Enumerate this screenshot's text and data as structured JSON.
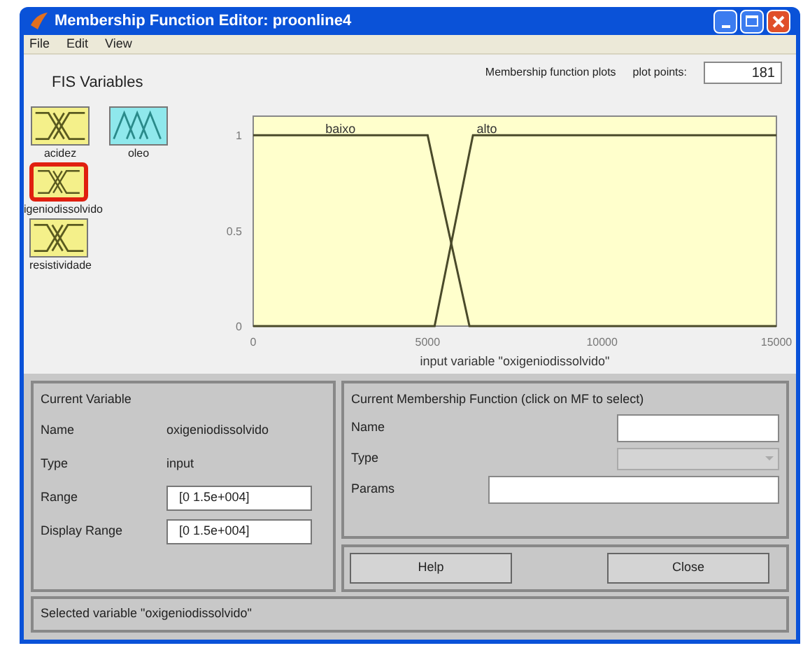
{
  "window": {
    "title": "Membership Function Editor: proonline4"
  },
  "menu": [
    "File",
    "Edit",
    "View"
  ],
  "fis_variables": {
    "title": "FIS Variables",
    "items": [
      {
        "label": "acidez",
        "kind": "input",
        "selected": false
      },
      {
        "label": "oleo",
        "kind": "output",
        "selected": false
      },
      {
        "label": "igeniodissolvido",
        "kind": "input",
        "selected": true
      },
      {
        "label": "resistividade",
        "kind": "input",
        "selected": false
      }
    ]
  },
  "plot_header": {
    "label": "Membership function plots",
    "plot_points_label": "plot points:",
    "plot_points": "181"
  },
  "chart_data": {
    "type": "line",
    "xlabel": "input variable \"oxigeniodissolvido\"",
    "x": [
      0,
      5000,
      5200,
      6200,
      6300,
      15000
    ],
    "xlim": [
      0,
      15000
    ],
    "ylim": [
      0,
      1.1
    ],
    "xticks": [
      0,
      5000,
      10000,
      15000
    ],
    "yticks": [
      0,
      0.5,
      1
    ],
    "series": [
      {
        "name": "baixo",
        "color": "#4a4a2a",
        "values": [
          1,
          1,
          0.83,
          0,
          0,
          0
        ]
      },
      {
        "name": "alto",
        "color": "#4a4a2a",
        "values": [
          0,
          0,
          0,
          0.91,
          1,
          1
        ]
      }
    ]
  },
  "current_variable": {
    "title": "Current Variable",
    "rows": [
      {
        "label": "Name",
        "value": "oxigeniodissolvido",
        "kind": "text"
      },
      {
        "label": "Type",
        "value": "input",
        "kind": "text"
      },
      {
        "label": "Range",
        "value": "[0 1.5e+004]",
        "kind": "field"
      },
      {
        "label": "Display Range",
        "value": "[0 1.5e+004]",
        "kind": "field"
      }
    ]
  },
  "current_mf": {
    "title": "Current Membership Function (click on MF to select)",
    "name_label": "Name",
    "type_label": "Type",
    "type_disabled": true,
    "params_label": "Params"
  },
  "buttons": [
    "Help",
    "Close"
  ],
  "status_bar": "Selected variable \"oxigeniodissolvido\""
}
